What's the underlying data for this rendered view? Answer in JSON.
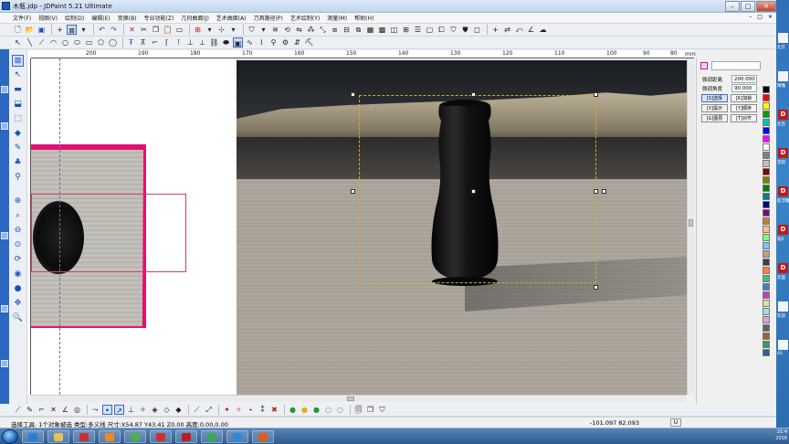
{
  "window": {
    "title": "木瓶.jdp - JDPaint 5.21 Ultimate",
    "minimize": "–",
    "maximize": "□",
    "close": "✕"
  },
  "menu": {
    "items": [
      "文件(F)",
      "视图(V)",
      "绘制(D)",
      "编辑(E)",
      "变换(B)",
      "专业功能(Z)",
      "几何曲面(J)",
      "艺术曲面(A)",
      "刀具路径(P)",
      "艺术绘制(Y)",
      "测量(M)",
      "帮助(H)"
    ],
    "mdi_buttons": [
      "–",
      "□",
      "✕"
    ]
  },
  "ruler": {
    "labels": [
      "200",
      "190",
      "180",
      "170",
      "160",
      "150",
      "140",
      "130",
      "120",
      "110",
      "100",
      "90",
      "80"
    ],
    "unit": "mm"
  },
  "right_panel": {
    "fields": [
      {
        "label": "微调距离",
        "value": "200.000"
      },
      {
        "label": "微调角度",
        "value": "90.000"
      }
    ],
    "buttons": [
      [
        "[S]选择",
        "[K]加锁"
      ],
      [
        "[X]提示",
        "[Y]顺序"
      ],
      [
        "[G]图层",
        "[T]对齐"
      ]
    ]
  },
  "palette": {
    "colors": [
      "#000000",
      "#ff0000",
      "#ffff00",
      "#00a000",
      "#00c0c0",
      "#0000ff",
      "#ff00ff",
      "#ffffff",
      "#808080",
      "#c0c0c0",
      "#800000",
      "#808000",
      "#008000",
      "#008080",
      "#000080",
      "#800080",
      "#c08040",
      "#ffc080",
      "#80ff80",
      "#80c0ff",
      "#c0a080",
      "#404040",
      "#ff8040",
      "#40c080",
      "#4080c0",
      "#c040c0",
      "#e0e0a0",
      "#a0e0e0",
      "#e0a0e0",
      "#606060",
      "#a06030",
      "#30a060",
      "#3060a0"
    ]
  },
  "status": {
    "text": "选择工具: 1个对象被选 类型:多义线 尺寸:X54.87 Y43.41 Z0.00 高度:0.00,0.00",
    "coords": "-101.097 82.093",
    "mode": "U"
  },
  "desktop": {
    "items": [
      {
        "label": "北京",
        "kind": "white"
      },
      {
        "label": "精雕",
        "kind": "white"
      },
      {
        "label": "北百",
        "kind": "red"
      },
      {
        "label": "花刻",
        "kind": "red"
      },
      {
        "label": "船浮雕",
        "kind": "red"
      },
      {
        "label": "笔6",
        "kind": "red"
      },
      {
        "label": "双面",
        "kind": "red"
      },
      {
        "label": "欢迎",
        "kind": "white"
      },
      {
        "label": "60",
        "kind": "white"
      }
    ],
    "tray_time": "21:4",
    "tray_date": "2016"
  }
}
